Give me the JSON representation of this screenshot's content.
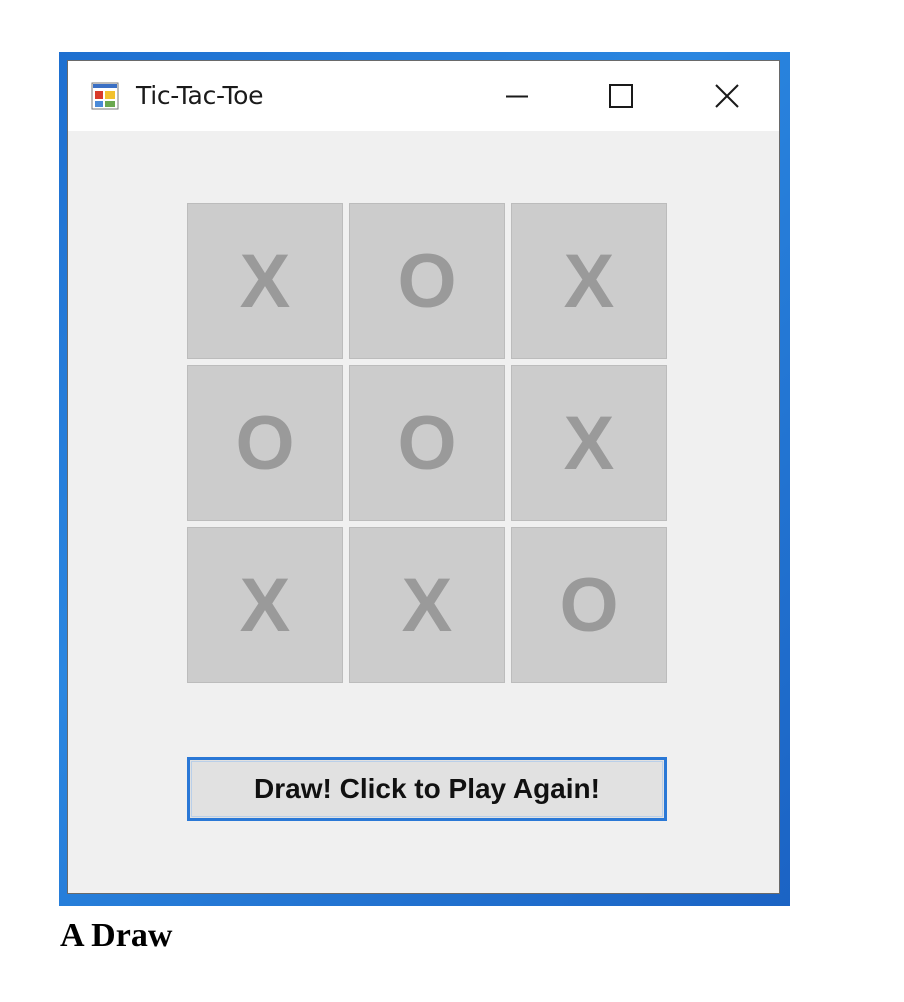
{
  "window": {
    "title": "Tic-Tac-Toe",
    "app_icon": "windows-form-app-icon",
    "controls": {
      "minimize_icon": "minimize-icon",
      "maximize_icon": "maximize-icon",
      "close_icon": "close-icon"
    }
  },
  "board": {
    "cells": [
      [
        "X",
        "O",
        "X"
      ],
      [
        "O",
        "O",
        "X"
      ],
      [
        "X",
        "X",
        "O"
      ]
    ]
  },
  "play_again_button": {
    "label": "Draw! Click to Play Again!"
  },
  "caption": "A Draw",
  "colors": {
    "window_border_accent": "#1e6fd0",
    "cell_background": "#cccccc",
    "cell_text": "#9a9a9a",
    "button_focus_border": "#2a78d6"
  }
}
